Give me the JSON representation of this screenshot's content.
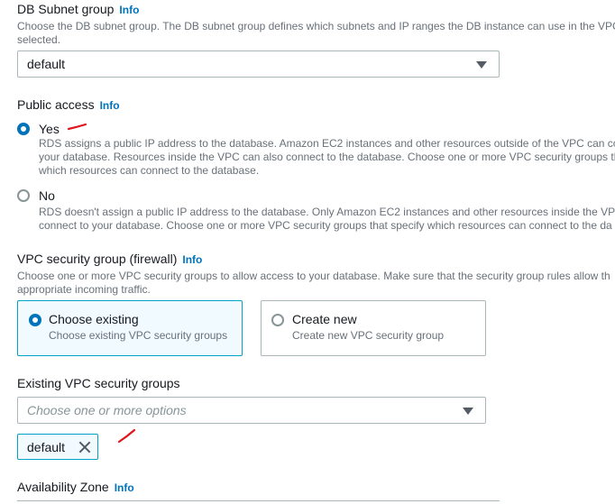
{
  "db_subnet": {
    "label": "DB Subnet group",
    "info": "Info",
    "desc_line1": "Choose the DB subnet group. The DB subnet group defines which subnets and IP ranges the DB instance can use in the VPC",
    "desc_line2": "selected.",
    "selected": "default"
  },
  "public_access": {
    "label": "Public access",
    "info": "Info",
    "options": [
      {
        "label": "Yes",
        "selected": true,
        "desc_lines": [
          "RDS assigns a public IP address to the database. Amazon EC2 instances and other resources outside of the VPC can con",
          "your database. Resources inside the VPC can also connect to the database. Choose one or more VPC security groups th",
          "which resources can connect to the database."
        ]
      },
      {
        "label": "No",
        "selected": false,
        "desc_lines": [
          "RDS doesn't assign a public IP address to the database. Only Amazon EC2 instances and other resources inside the VPC",
          "connect to your database. Choose one or more VPC security groups that specify which resources can connect to the da"
        ]
      }
    ]
  },
  "vpc_sg": {
    "label": "VPC security group (firewall)",
    "info": "Info",
    "desc_line1": "Choose one or more VPC security groups to allow access to your database. Make sure that the security group rules allow th",
    "desc_line2": "appropriate incoming traffic.",
    "cards": [
      {
        "title": "Choose existing",
        "sub": "Choose existing VPC security groups",
        "selected": true
      },
      {
        "title": "Create new",
        "sub": "Create new VPC security group",
        "selected": false
      }
    ]
  },
  "existing_sg": {
    "label": "Existing VPC security groups",
    "placeholder": "Choose one or more options",
    "tokens": [
      "default"
    ]
  },
  "az": {
    "label": "Availability Zone",
    "info": "Info"
  },
  "colors": {
    "link": "#0073bb",
    "selected_border": "#00a1c9",
    "selected_bg": "#f1faff",
    "annotation": "#e0161c"
  }
}
